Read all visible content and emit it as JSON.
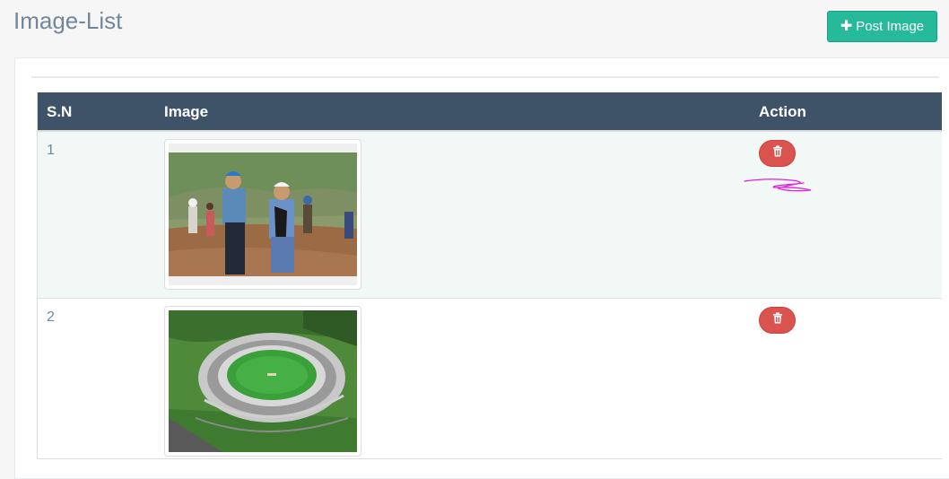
{
  "header": {
    "title": "Image-List",
    "post_button_label": "Post Image"
  },
  "table": {
    "columns": [
      "S.N",
      "Image",
      "Action"
    ],
    "rows": [
      {
        "sn": "1",
        "image": "construction-workers-photo",
        "action": "delete-icon"
      },
      {
        "sn": "2",
        "image": "stadium-aerial-photo",
        "action": "delete-icon"
      }
    ]
  },
  "colors": {
    "primary_button": "#26b99a",
    "delete_button": "#d9534f",
    "table_header": "#3e5368",
    "title_text": "#73879c",
    "row_highlight": "#f1f8f6",
    "scribble": "#e020e0"
  },
  "icons": {
    "post_button": "plus-icon",
    "delete_button": "trash-icon"
  }
}
